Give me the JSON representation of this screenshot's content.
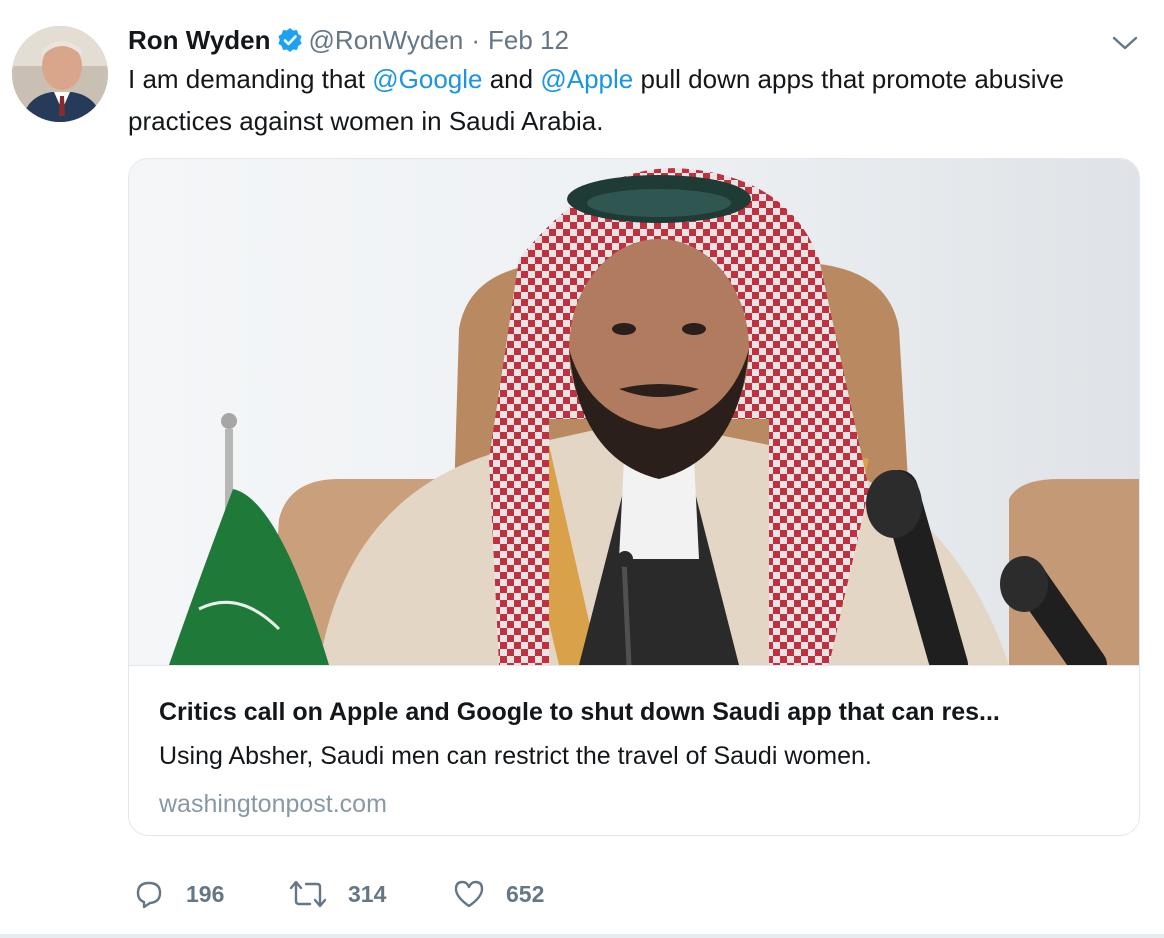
{
  "tweet": {
    "author_name": "Ron Wyden",
    "handle": "@RonWyden",
    "separator": "·",
    "date": "Feb 12",
    "text_parts": {
      "p1": "I am demanding that ",
      "mention1": "@Google",
      "p2": " and ",
      "mention2": "@Apple",
      "p3": " pull down apps that promote abusive practices against women in Saudi Arabia."
    }
  },
  "card": {
    "title": "Critics call on Apple and Google to shut down Saudi app that can res...",
    "description": "Using Absher, Saudi men can restrict the travel of Saudi women.",
    "domain": "washingtonpost.com"
  },
  "actions": {
    "replies": "196",
    "retweets": "314",
    "likes": "652"
  },
  "icons": {
    "verified": "verified-badge-icon",
    "caret": "chevron-down-icon",
    "reply": "reply-icon",
    "retweet": "retweet-icon",
    "like": "heart-icon"
  },
  "colors": {
    "link": "#1b95e0",
    "secondary_text": "#657786",
    "border": "#e1e8ed"
  }
}
